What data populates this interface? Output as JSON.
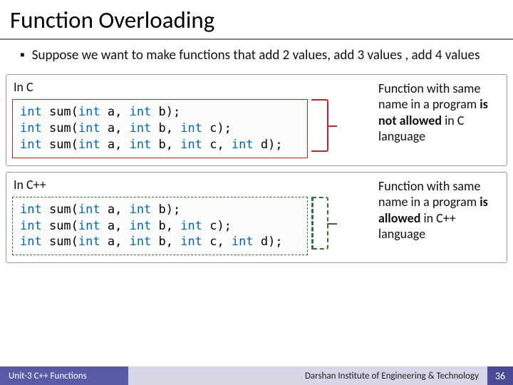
{
  "title": "Function Overloading",
  "bullet": "Suppose we want to make functions that add 2 values, add 3 values , add 4 values",
  "sections": {
    "c": {
      "label": "In C",
      "code": {
        "lines": [
          [
            {
              "k": "int"
            },
            {
              "t": " sum("
            },
            {
              "k": "int"
            },
            {
              "t": " a, "
            },
            {
              "k": "int"
            },
            {
              "t": " b);"
            }
          ],
          [
            {
              "k": "int"
            },
            {
              "t": " sum("
            },
            {
              "k": "int"
            },
            {
              "t": " a, "
            },
            {
              "k": "int"
            },
            {
              "t": " b, "
            },
            {
              "k": "int"
            },
            {
              "t": " c);"
            }
          ],
          [
            {
              "k": "int"
            },
            {
              "t": " sum("
            },
            {
              "k": "int"
            },
            {
              "t": " a, "
            },
            {
              "k": "int"
            },
            {
              "t": " b, "
            },
            {
              "k": "int"
            },
            {
              "t": " c, "
            },
            {
              "k": "int"
            },
            {
              "t": " d);"
            }
          ]
        ]
      },
      "explain_pre": "Function with same name in a program ",
      "explain_bold": "is not allowed",
      "explain_post": " in C language"
    },
    "cpp": {
      "label": "In C++",
      "code": {
        "lines": [
          [
            {
              "k": "int"
            },
            {
              "t": " sum("
            },
            {
              "k": "int"
            },
            {
              "t": " a, "
            },
            {
              "k": "int"
            },
            {
              "t": " b);"
            }
          ],
          [
            {
              "k": "int"
            },
            {
              "t": " sum("
            },
            {
              "k": "int"
            },
            {
              "t": " a, "
            },
            {
              "k": "int"
            },
            {
              "t": " b, "
            },
            {
              "k": "int"
            },
            {
              "t": " c);"
            }
          ],
          [
            {
              "k": "int"
            },
            {
              "t": " sum("
            },
            {
              "k": "int"
            },
            {
              "t": " a, "
            },
            {
              "k": "int"
            },
            {
              "t": " b, "
            },
            {
              "k": "int"
            },
            {
              "t": " c, "
            },
            {
              "k": "int"
            },
            {
              "t": " d);"
            }
          ]
        ]
      },
      "explain_pre": "Function with same name in a program ",
      "explain_bold": "is allowed",
      "explain_post": " in C++ language"
    }
  },
  "footer": {
    "left": "Unit-3 C++ Functions",
    "mid": "Darshan Institute of Engineering & Technology",
    "page": "36"
  }
}
